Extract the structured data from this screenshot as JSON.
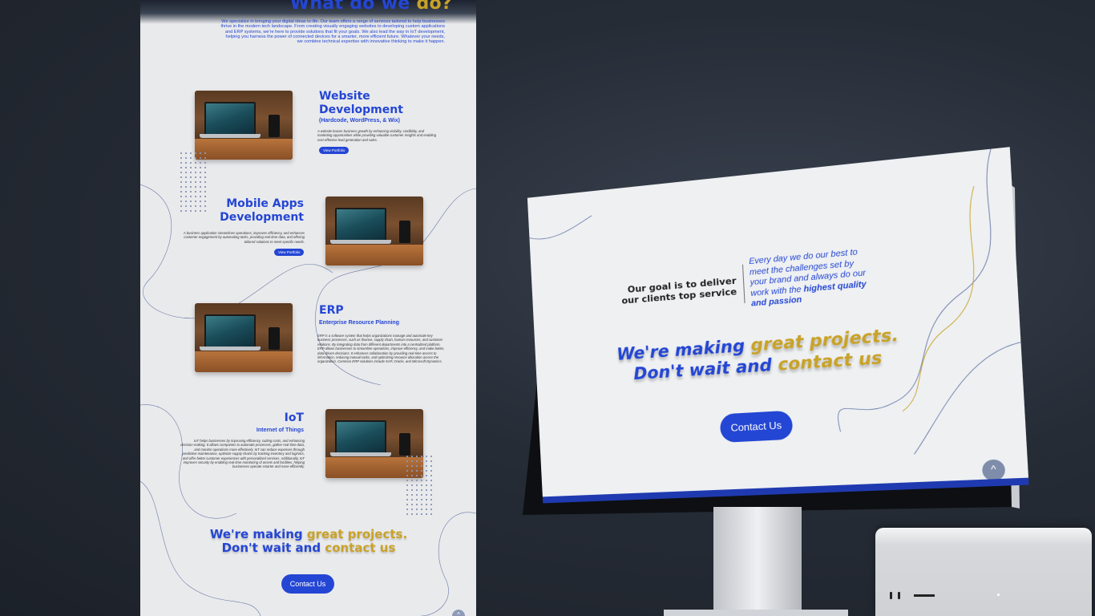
{
  "page": {
    "hero": {
      "title_main": "What do we ",
      "title_accent": "do?",
      "description": "We specialize in bringing your digital ideas to life. Our team offers a range of services tailored to help businesses thrive in the modern tech landscape. From creating visually engaging websites to developing custom applications and ERP systems, we're here to provide solutions that fit your goals. We also lead the way in IoT development, helping you harness the power of connected devices for a smarter, more efficient future. Whatever your needs, we combine technical expertise with innovative thinking to make it happen."
    },
    "services": [
      {
        "title": "Website Development",
        "subtitle": "(Hardcode, WordPress, & Wix)",
        "description": "A website boosts business growth by enhancing visibility, credibility, and marketing opportunities while providing valuable customer insights and enabling cost-effective lead generation and sales.",
        "button": "View Portfolio"
      },
      {
        "title": "Mobile Apps Development",
        "subtitle": "",
        "description": "A business application streamlines operations, improves efficiency, and enhances customer engagement by automating tasks, providing real-time data, and offering tailored solutions to meet specific needs.",
        "button": "View Portfolio"
      },
      {
        "title": "ERP",
        "subtitle": "Enterprise Resource Planning",
        "description": "ERP is a software system that helps organizations manage and automate key business processes, such as finance, supply chain, human resources, and customer relations. By integrating data from different departments into a centralized platform, ERP allows businesses to streamline operations, improve efficiency, and make better, data-driven decisions. It enhances collaboration by providing real-time access to information, reducing manual tasks, and optimizing resource allocation across the organization. Common ERP solutions include SAP, Oracle, and Microsoft Dynamics.",
        "button": ""
      },
      {
        "title": "IoT",
        "subtitle": "Internet of Things",
        "description": "IoT helps businesses by improving efficiency, cutting costs, and enhancing decision-making. It allows companies to automate processes, gather real-time data, and monitor operations more effectively. IoT can reduce expenses through predictive maintenance, optimize supply chains by tracking inventory and logistics, and offer better customer experiences with personalized services. Additionally, IoT improves security by enabling real-time monitoring of assets and facilities, helping businesses operate smarter and more efficiently.",
        "button": ""
      }
    ],
    "cta": {
      "line1_main": "We're making ",
      "line1_accent": "great projects.",
      "line2_main": "Don't wait and ",
      "line2_accent": "contact us",
      "button": "Contact Us"
    },
    "scroll_top_icon": "chevron-up-icon"
  },
  "monitor": {
    "goal_text": "Our goal is to deliver our clients top service",
    "mission_text": "Every day we do our best to meet the challenges set by your brand and always do our work with the ",
    "mission_bold": "highest quality and passion",
    "cta": {
      "line1_main": "We're making ",
      "line1_accent": "great projects.",
      "line2_main": "Don't wait and ",
      "line2_accent": "contact us",
      "button": "Contact Us"
    },
    "scroll_top_icon": "chevron-up-icon"
  },
  "colors": {
    "brand_blue": "#2446d4",
    "accent_gold": "#c9a227",
    "page_bg": "#e9eaec",
    "backdrop": "#262c36"
  }
}
